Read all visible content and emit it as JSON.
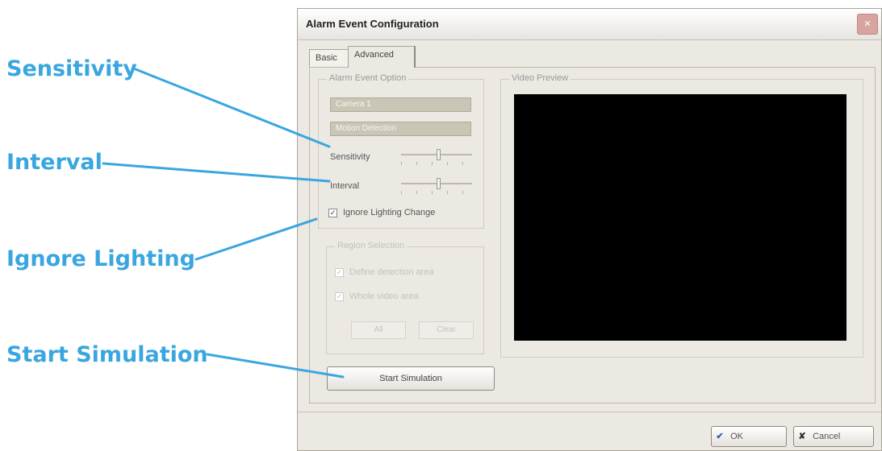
{
  "callouts": {
    "sensitivity": "Sensitivity",
    "interval": "Interval",
    "ignore_lighting": "Ignore Lighting",
    "start_simulation": "Start Simulation"
  },
  "dialog": {
    "title": "Alarm Event Configuration",
    "close_glyph": "×",
    "tabs": [
      {
        "label": "Basic",
        "active": false
      },
      {
        "label": "Advanced",
        "active": true
      }
    ],
    "alarm_option_group": {
      "label": "Alarm Event Option",
      "field_1": "Camera 1",
      "field_2": "Motion Detection",
      "sensitivity_label": "Sensitivity",
      "interval_label": "Interval",
      "ignore_lighting_label": "Ignore Lighting Change",
      "ignore_lighting_checked": true
    },
    "region_group": {
      "label": "Region Selection",
      "option_1": "Define detection area",
      "option_2": "Whole video area",
      "all_button": "All",
      "clear_button": "Clear"
    },
    "start_simulation_button": "Start Simulation",
    "video_preview_label": "Video Preview",
    "ok_button": "OK",
    "cancel_button": "Cancel"
  },
  "colors": {
    "callout": "#3aa6e0",
    "preview_background": "#000000"
  },
  "icons": {
    "ok": "checkmark-icon",
    "cancel": "x-icon",
    "close": "close-icon"
  }
}
